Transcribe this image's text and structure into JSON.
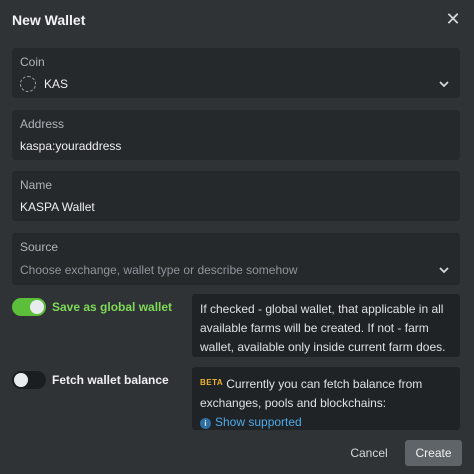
{
  "dialog": {
    "title": "New Wallet"
  },
  "coin": {
    "label": "Coin",
    "value": "KAS",
    "icon": "coin-placeholder-icon"
  },
  "address": {
    "label": "Address",
    "value": "kaspa:youraddress"
  },
  "name": {
    "label": "Name",
    "value": "KASPA Wallet"
  },
  "source": {
    "label": "Source",
    "placeholder": "Choose exchange, wallet type or describe somehow"
  },
  "global_wallet": {
    "label": "Save as global wallet",
    "checked": true,
    "info_line1": "If checked - global wallet, that applicable in all",
    "info_line2": "available farms will be created. If not - farm",
    "info_line3": "wallet, available only inside current farm does."
  },
  "fetch_balance": {
    "label": "Fetch wallet balance",
    "checked": false,
    "beta": "BETA",
    "info_line1": "Currently you can fetch balance from",
    "info_line2": "exchanges, pools and blockchains:",
    "link": "Show supported"
  },
  "buttons": {
    "cancel": "Cancel",
    "create": "Create"
  },
  "colors": {
    "accent_green": "#5bbf3a",
    "link_blue": "#4fa8e8",
    "beta_yellow": "#f0b429"
  }
}
